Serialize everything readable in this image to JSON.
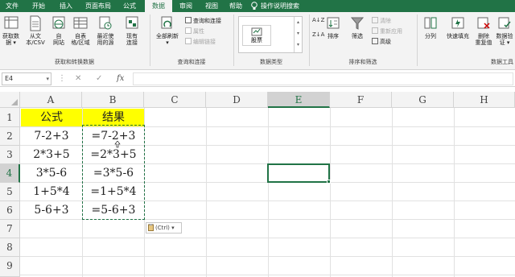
{
  "tabs": [
    {
      "label": "文件",
      "active": false
    },
    {
      "label": "开始",
      "active": false
    },
    {
      "label": "插入",
      "active": false
    },
    {
      "label": "页面布局",
      "active": false
    },
    {
      "label": "公式",
      "active": false
    },
    {
      "label": "数据",
      "active": true
    },
    {
      "label": "审阅",
      "active": false
    },
    {
      "label": "视图",
      "active": false
    },
    {
      "label": "帮助",
      "active": false
    }
  ],
  "tell_me": "操作说明搜索",
  "ribbon": {
    "get_data": {
      "buttons": [
        {
          "line1": "获取数",
          "line2": "据 ▾"
        },
        {
          "line1": "从文",
          "line2": "本/CSV"
        },
        {
          "line1": "自",
          "line2": "网站"
        },
        {
          "line1": "自表",
          "line2": "格/区域"
        },
        {
          "line1": "最近使",
          "line2": "用的源"
        },
        {
          "line1": "现有",
          "line2": "连接"
        }
      ],
      "group_label": "获取和转换数据"
    },
    "queries": {
      "refresh_line1": "全部刷新",
      "refresh_line2": "▾",
      "items": [
        "查询和连接",
        "属性",
        "编辑链接"
      ],
      "group_label": "查询和连接"
    },
    "data_types": {
      "stock": "股票",
      "group_label": "数据类型"
    },
    "sort_filter": {
      "sort": "排序",
      "filter": "筛选",
      "clear": "清除",
      "reapply": "重新应用",
      "advanced": "高级",
      "group_label": "排序和筛选"
    },
    "data_tools": {
      "split": "分列",
      "flash_fill": "快速填充",
      "remove_dup_line1": "删除",
      "remove_dup_line2": "重复值",
      "validation_line1": "数据验",
      "validation_line2": "证 ▾",
      "group_label": "数据工具"
    }
  },
  "formula_bar": {
    "name_box": "E4",
    "name_arrow": "▾",
    "more": "⋮",
    "cancel": "✕",
    "enter": "✓",
    "fx": "fx"
  },
  "grid": {
    "columns": [
      "A",
      "B",
      "C",
      "D",
      "E",
      "F",
      "G",
      "H"
    ],
    "rows": [
      "1",
      "2",
      "3",
      "4",
      "5",
      "6",
      "7",
      "8",
      "9"
    ],
    "selected_column": "E",
    "selected_row": "4",
    "header": {
      "a": "公式",
      "b": "结果"
    },
    "data_rows": [
      {
        "a": "7-2+3",
        "b": "=7-2+3"
      },
      {
        "a": "2*3+5",
        "b": "=2*3+5"
      },
      {
        "a": "3*5-6",
        "b": "=3*5-6"
      },
      {
        "a": "1+5*4",
        "b": "=1+5*4"
      },
      {
        "a": "5-6+3",
        "b": "=5-6+3"
      }
    ],
    "paste_options_label": "(Ctrl) ▾"
  },
  "colors": {
    "accent": "#217346",
    "header_fill": "#ffff00",
    "grid_line": "#e1e1e1"
  }
}
